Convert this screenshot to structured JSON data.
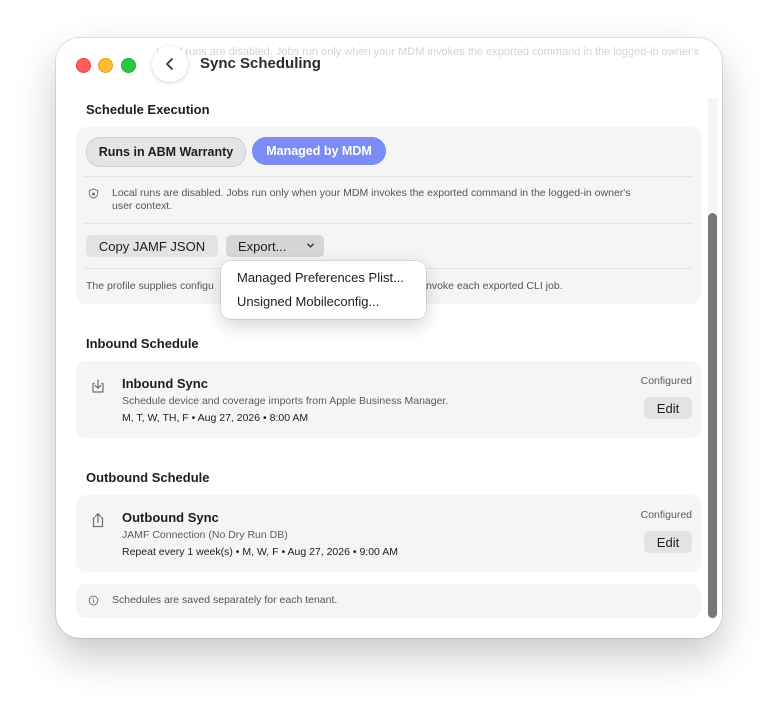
{
  "window": {
    "title": "Sync Scheduling",
    "ghost_text": "Local runs are disabled. Jobs run only when your MDM invokes the exported command in the logged-in owner's"
  },
  "schedule_execution": {
    "title": "Schedule Execution",
    "segments": [
      {
        "label": "Runs in ABM Warranty",
        "selected": false
      },
      {
        "label": "Managed by MDM",
        "selected": true
      }
    ],
    "notice_line1": "Local runs are disabled. Jobs run only when your MDM invokes the exported command in the logged-in owner's",
    "notice_line2": "user context.",
    "copy_button": "Copy JAMF JSON",
    "export_button": "Export...",
    "profile_note_left": "The profile supplies configu",
    "profile_note_right": "nvoke each exported CLI job."
  },
  "export_menu": {
    "items": [
      "Managed Preferences Plist...",
      "Unsigned Mobileconfig..."
    ]
  },
  "inbound": {
    "section_title": "Inbound Schedule",
    "title": "Inbound Sync",
    "subtitle": "Schedule device and coverage imports from Apple Business Manager.",
    "meta": "M, T, W, TH, F • Aug 27, 2026 • 8:00 AM",
    "status": "Configured",
    "edit_label": "Edit"
  },
  "outbound": {
    "section_title": "Outbound Schedule",
    "title": "Outbound Sync",
    "subtitle": "JAMF Connection (No Dry Run DB)",
    "meta": "Repeat every 1 week(s) • M, W, F • Aug 27, 2026 • 9:00 AM",
    "status": "Configured",
    "edit_label": "Edit"
  },
  "footer_note": "Schedules are saved separately for each tenant.",
  "colors": {
    "accent": "#7b8cf4",
    "close": "#ff5f57",
    "minimize": "#febc2e",
    "zoom": "#28c840"
  }
}
